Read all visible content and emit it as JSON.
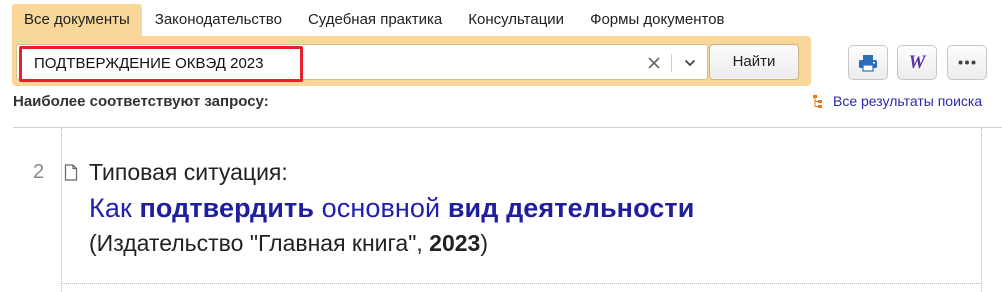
{
  "tabs": [
    {
      "label": "Все документы",
      "active": true
    },
    {
      "label": "Законодательство"
    },
    {
      "label": "Судебная практика"
    },
    {
      "label": "Консультации"
    },
    {
      "label": "Формы документов"
    }
  ],
  "search": {
    "query": "ПОДТВЕРЖДЕНИЕ ОКВЭД 2023",
    "find_label": "Найти"
  },
  "toolbar": {
    "print_icon": "printer-icon",
    "word_icon": "word-export-icon",
    "word_glyph": "W",
    "more_icon": "more-icon"
  },
  "results_header": {
    "heading": "Наиболее соответствуют запросу:",
    "all_results_label": "Все результаты поиска"
  },
  "result": {
    "number": "2",
    "type": "Типовая ситуация:",
    "title_parts": [
      {
        "text": "Как ",
        "bold": false
      },
      {
        "text": "подтвердить",
        "bold": true
      },
      {
        "text": " основной ",
        "bold": false
      },
      {
        "text": "вид деятельности",
        "bold": true
      }
    ],
    "source_prefix": "(Издательство \"Главная книга\", ",
    "source_year": "2023",
    "source_suffix": ")"
  },
  "colors": {
    "tab_active_bg": "#f9d79a",
    "search_panel_bg": "#f9d79a",
    "query_highlight_border": "#e8202a",
    "title_link": "#2020b0",
    "all_results_link": "#2a2aa8"
  }
}
